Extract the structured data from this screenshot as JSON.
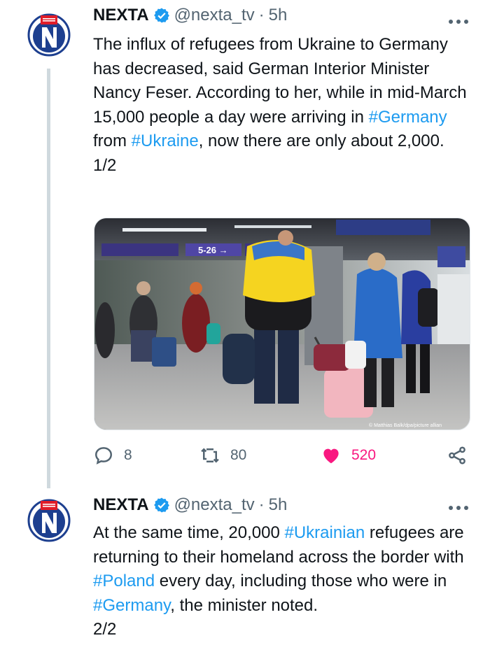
{
  "colors": {
    "link": "#1d9bf0",
    "muted": "#536471",
    "like": "#f91880",
    "verified": "#1d9bf0",
    "brand_red": "#e01c28",
    "brand_blue": "#1d3f8f"
  },
  "tweets": [
    {
      "author": "NEXTA",
      "handle": "@nexta_tv",
      "sep": "·",
      "time": "5h",
      "text_parts": {
        "p1": "The influx of refugees from Ukraine to Germany has decreased, said German Interior Minister Nancy Feser. According to her, while in mid-March 15,000 people a day were arriving in ",
        "tag1": "#Germany",
        "p2": " from ",
        "tag2": "#Ukraine",
        "p3": ", now there are only about 2,000.",
        "counter": "1/2"
      },
      "media": {
        "board_left": "5-26 →",
        "photo_credit": "© Matthias Balk/dpa/picture allian"
      },
      "actions": {
        "replies": "8",
        "retweets": "80",
        "likes": "520"
      },
      "icons": [
        "reply-icon",
        "retweet-icon",
        "heart-icon",
        "share-icon"
      ]
    },
    {
      "author": "NEXTA",
      "handle": "@nexta_tv",
      "sep": "·",
      "time": "5h",
      "text_parts": {
        "p1": "At the same time, 20,000 ",
        "tag1": "#Ukrainian",
        "p2": " refugees are returning to their homeland across the border with ",
        "tag2": "#Poland",
        "p3": " every day, including those who were in ",
        "tag3": "#Germany",
        "p4": ", the minister noted.",
        "counter": "2/2"
      }
    }
  ]
}
